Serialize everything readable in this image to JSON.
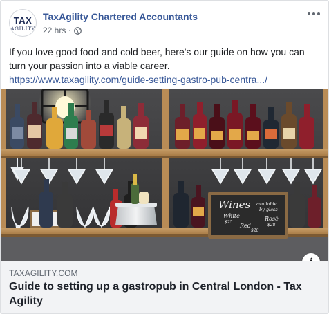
{
  "post": {
    "page_name": "TaxAgility Chartered Accountants",
    "timestamp": "22 hrs",
    "separator": "·",
    "privacy_icon": "globe-icon",
    "avatar": {
      "logo_top": "TAX",
      "logo_bottom": "AGILITY"
    },
    "message": "If you love good food and cold beer, here's our guide on how you can turn your passion into a viable career.",
    "link_text": "https://www.taxagility.com/guide-setting-gastro-pub-centra.../"
  },
  "image": {
    "board": {
      "title": "Wines",
      "subtitle_1": "available",
      "subtitle_2": "by glass",
      "white_label": "White",
      "white_price": "$25",
      "rose_label": "Rosé",
      "rose_price": "$28",
      "red_label": "Red",
      "red_price": "$28"
    }
  },
  "link_preview": {
    "domain": "TAXAGILITY.COM",
    "title": "Guide to setting up a gastropub in Central London - Tax Agility"
  },
  "icons": {
    "more": "more-options-icon",
    "info": "info-icon"
  }
}
